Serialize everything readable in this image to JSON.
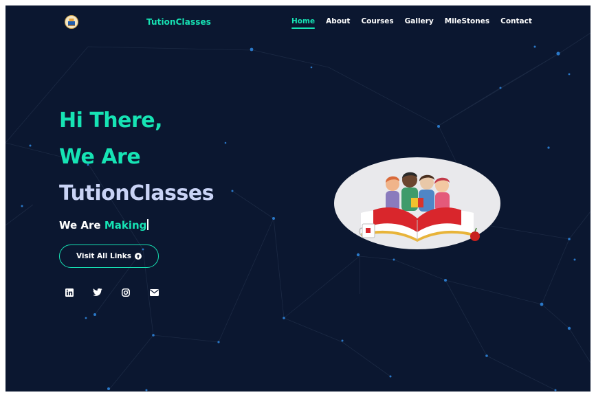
{
  "brand": {
    "name": "TutionClasses",
    "logo_icon": "books-emblem-icon"
  },
  "nav": {
    "items": [
      {
        "label": "Home",
        "active": true
      },
      {
        "label": "About",
        "active": false
      },
      {
        "label": "Courses",
        "active": false
      },
      {
        "label": "Gallery",
        "active": false
      },
      {
        "label": "MileStones",
        "active": false
      },
      {
        "label": "Contact",
        "active": false
      }
    ]
  },
  "hero": {
    "line1": "Hi There,",
    "line2": "We Are",
    "line3": "TutionClasses",
    "typing_prefix": "We Are ",
    "typing_word": "Making",
    "button_label": "Visit All Links",
    "button_icon": "arrow-circle-up-icon"
  },
  "socials": [
    {
      "name": "linkedin",
      "icon": "linkedin-icon"
    },
    {
      "name": "twitter",
      "icon": "twitter-icon"
    },
    {
      "name": "instagram",
      "icon": "instagram-icon"
    },
    {
      "name": "email",
      "icon": "envelope-icon"
    }
  ],
  "colors": {
    "background": "#0b1730",
    "accent": "#16e3b4",
    "heading_light": "#c9d3f5",
    "dot": "#2a78c8"
  },
  "illustration": "students-reading-book-illustration"
}
